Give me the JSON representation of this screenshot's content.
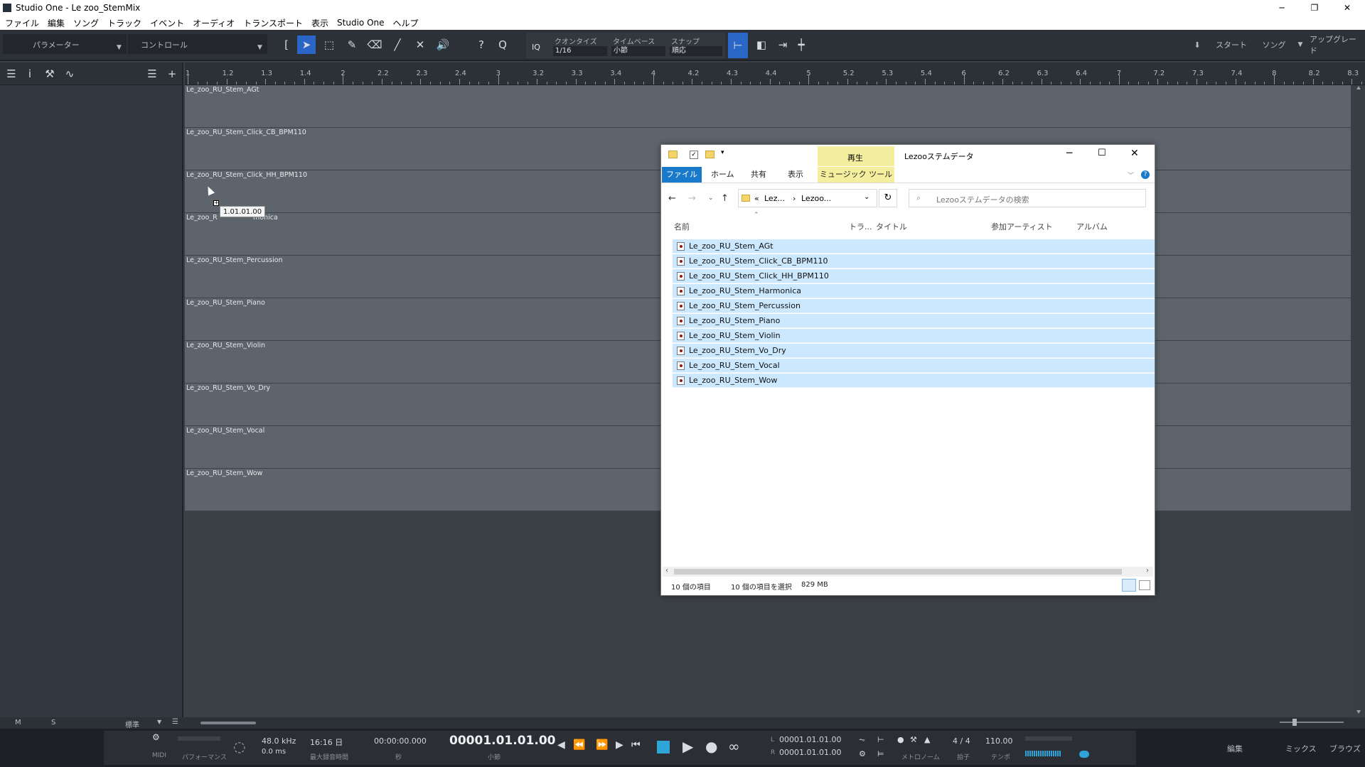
{
  "window": {
    "title": "Studio One - Le zoo_StemMix",
    "minimize": "─",
    "maximize": "❐",
    "close": "✕"
  },
  "menu": [
    "ファイル",
    "編集",
    "ソング",
    "トラック",
    "イベント",
    "オーディオ",
    "トランスポート",
    "表示",
    "Studio One",
    "ヘルプ"
  ],
  "toolbar": {
    "tab_parameters": "パラメーター",
    "tab_control": "コントロール",
    "iq_label": "IQ",
    "quantize_label": "クオンタイズ",
    "quantize_value": "1/16",
    "timebase_label": "タイムベース",
    "timebase_value": "小節",
    "snap_label": "スナップ",
    "snap_value": "順応",
    "start": "スタート",
    "song": "ソング",
    "upgrade": "アップグレード"
  },
  "ruler": {
    "marks": [
      {
        "label": "1",
        "major": true
      },
      {
        "label": "1.2"
      },
      {
        "label": "1.3"
      },
      {
        "label": "1.4"
      },
      {
        "label": "2",
        "major": true
      },
      {
        "label": "2.2"
      },
      {
        "label": "2.3"
      },
      {
        "label": "2.4"
      },
      {
        "label": "3",
        "major": true
      },
      {
        "label": "3.2"
      },
      {
        "label": "3.3"
      },
      {
        "label": "3.4"
      },
      {
        "label": "4",
        "major": true
      },
      {
        "label": "4.2"
      },
      {
        "label": "4.3"
      },
      {
        "label": "4.4"
      },
      {
        "label": "5",
        "major": true
      },
      {
        "label": "5.2"
      },
      {
        "label": "5.3"
      },
      {
        "label": "5.4"
      },
      {
        "label": "6",
        "major": true
      },
      {
        "label": "6.2"
      },
      {
        "label": "6.3"
      },
      {
        "label": "6.4"
      },
      {
        "label": "7",
        "major": true
      },
      {
        "label": "7.2"
      },
      {
        "label": "7.3"
      },
      {
        "label": "7.4"
      },
      {
        "label": "8",
        "major": true
      },
      {
        "label": "8.2"
      },
      {
        "label": "8.3"
      }
    ]
  },
  "tracks": [
    "Le_zoo_RU_Stem_AGt",
    "Le_zoo_RU_Stem_Click_CB_BPM110",
    "Le_zoo_RU_Stem_Click_HH_BPM110",
    "Le_zoo_RU_Stem_Harmonica",
    "Le_zoo_RU_Stem_Percussion",
    "Le_zoo_RU_Stem_Piano",
    "Le_zoo_RU_Stem_Violin",
    "Le_zoo_RU_Stem_Vo_Dry",
    "Le_zoo_RU_Stem_Vocal",
    "Le_zoo_RU_Stem_Wow"
  ],
  "track_name_visible": [
    "Le_zoo_RU_Stem_AGt",
    "Le_zoo_RU_Stem_Click_CB_BPM110",
    "Le_zoo_RU_Stem_Click_HH_BPM110",
    "Le_zoo_R",
    "monica",
    "Le_zoo_RU_Stem_Percussion",
    "Le_zoo_RU_Stem_Piano",
    "Le_zoo_RU_Stem_Violin",
    "Le_zoo_RU_Stem_Vo_Dry",
    "Le_zoo_RU_Stem_Vocal",
    "Le_zoo_RU_Stem_Wow"
  ],
  "tooltip": "1.01.01.00",
  "bottom": {
    "m": "M",
    "s": "S",
    "view": "標準"
  },
  "transport": {
    "midi": "MIDI",
    "performance": "パフォーマンス",
    "sample_rate": "48.0 kHz",
    "latency": "0.0 ms",
    "record_time": "16:16 日",
    "record_time_label": "最大録音時間",
    "time_seconds": "00:00:00.000",
    "time_seconds_label": "秒",
    "position": "00001.01.01.00",
    "position_label": "小節",
    "loop_l_label": "L",
    "loop_l": "00001.01.01.00",
    "loop_r_label": "R",
    "loop_r": "00001.01.01.00",
    "metronome_label": "メトロノーム",
    "signature": "4 / 4",
    "signature_label": "拍子",
    "tempo": "110.00",
    "tempo_label": "テンポ",
    "edit": "編集",
    "mix": "ミックス",
    "browse": "ブラウズ"
  },
  "explorer": {
    "title": "Lezooステムデータ",
    "ribbon_context": "再生",
    "tabs": {
      "file": "ファイル",
      "home": "ホーム",
      "share": "共有",
      "view": "表示",
      "music_tools": "ミュージック ツール"
    },
    "breadcrumb": [
      "«",
      "Lez...",
      "›",
      "Lezoo..."
    ],
    "search_placeholder": "Lezooステムデータの検索",
    "columns": {
      "name": "名前",
      "track": "トラ...",
      "title": "タイトル",
      "artists": "参加アーティスト",
      "album": "アルバム"
    },
    "files": [
      "Le_zoo_RU_Stem_AGt",
      "Le_zoo_RU_Stem_Click_CB_BPM110",
      "Le_zoo_RU_Stem_Click_HH_BPM110",
      "Le_zoo_RU_Stem_Harmonica",
      "Le_zoo_RU_Stem_Percussion",
      "Le_zoo_RU_Stem_Piano",
      "Le_zoo_RU_Stem_Violin",
      "Le_zoo_RU_Stem_Vo_Dry",
      "Le_zoo_RU_Stem_Vocal",
      "Le_zoo_RU_Stem_Wow"
    ],
    "status_count": "10 個の項目",
    "status_selected": "10 個の項目を選択",
    "status_size": "829 MB"
  },
  "colors": {
    "accent": "#2a66c6",
    "selection": "#cce8ff",
    "track_bg": "#5d646c",
    "ribbon_context": "#f4ef9f"
  }
}
